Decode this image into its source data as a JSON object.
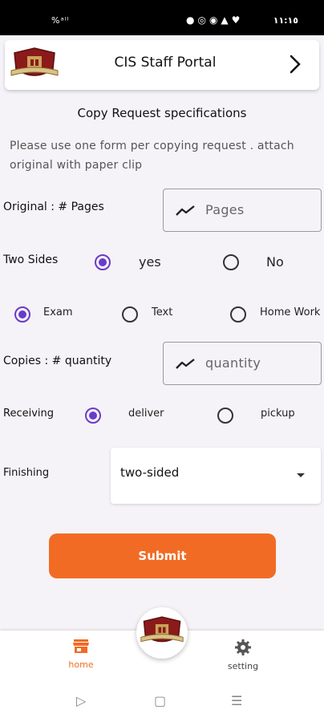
{
  "status_bar": {
    "left_text": "%ᵃˡˡ",
    "time": "١١:١٥"
  },
  "header": {
    "title": "CIS Staff Portal",
    "logo": "school-crest-logo",
    "chevron": "chevron-right-icon"
  },
  "section_title": "Copy Request specifications",
  "instructions": "Please use one form per copying request . attach original with paper clip",
  "original_pages": {
    "label": "Original : # Pages",
    "placeholder": "Pages",
    "icon": "trend-line-icon"
  },
  "two_sides": {
    "label": "Two Sides",
    "options": [
      "yes",
      "No"
    ],
    "selected": "yes"
  },
  "request_type": {
    "options": [
      "Exam",
      "Text",
      "Home Work"
    ],
    "selected": "Exam"
  },
  "copies": {
    "label": "Copies : # quantity",
    "placeholder": "quantity",
    "icon": "trend-line-icon"
  },
  "receiving": {
    "label": "Receiving",
    "options": [
      "deliver",
      "pickup"
    ],
    "selected": "deliver"
  },
  "finishing": {
    "label": "Finishing",
    "value": "two-sided"
  },
  "submit_label": "Submit",
  "bottom_nav": {
    "home": "home",
    "setting": "setting"
  },
  "system_nav": {
    "back": "▷",
    "home": "▢",
    "recents": "☰"
  },
  "colors": {
    "accent": "#6a3bc9",
    "primary": "#f26b24",
    "status_bar": "#000000"
  }
}
